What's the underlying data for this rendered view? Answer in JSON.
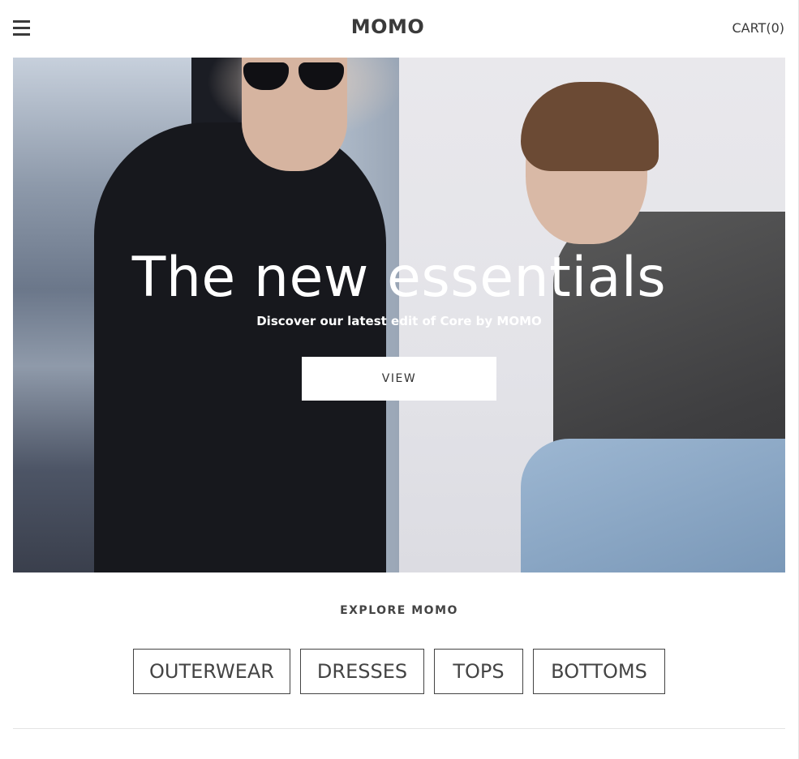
{
  "header": {
    "logo": "MOMO",
    "cart_label": "CART(0)",
    "menu_icon": "hamburger-menu-icon"
  },
  "hero": {
    "title": "The new essentials",
    "subtitle": "Discover our latest edit of Core by MOMO",
    "button_label": "VIEW"
  },
  "explore": {
    "title": "EXPLORE MOMO",
    "categories": [
      {
        "label": "OUTERWEAR"
      },
      {
        "label": "DRESSES"
      },
      {
        "label": "TOPS"
      },
      {
        "label": "BOTTOMS"
      }
    ]
  },
  "colors": {
    "text": "#333333",
    "border": "#444444",
    "background": "#ffffff"
  }
}
